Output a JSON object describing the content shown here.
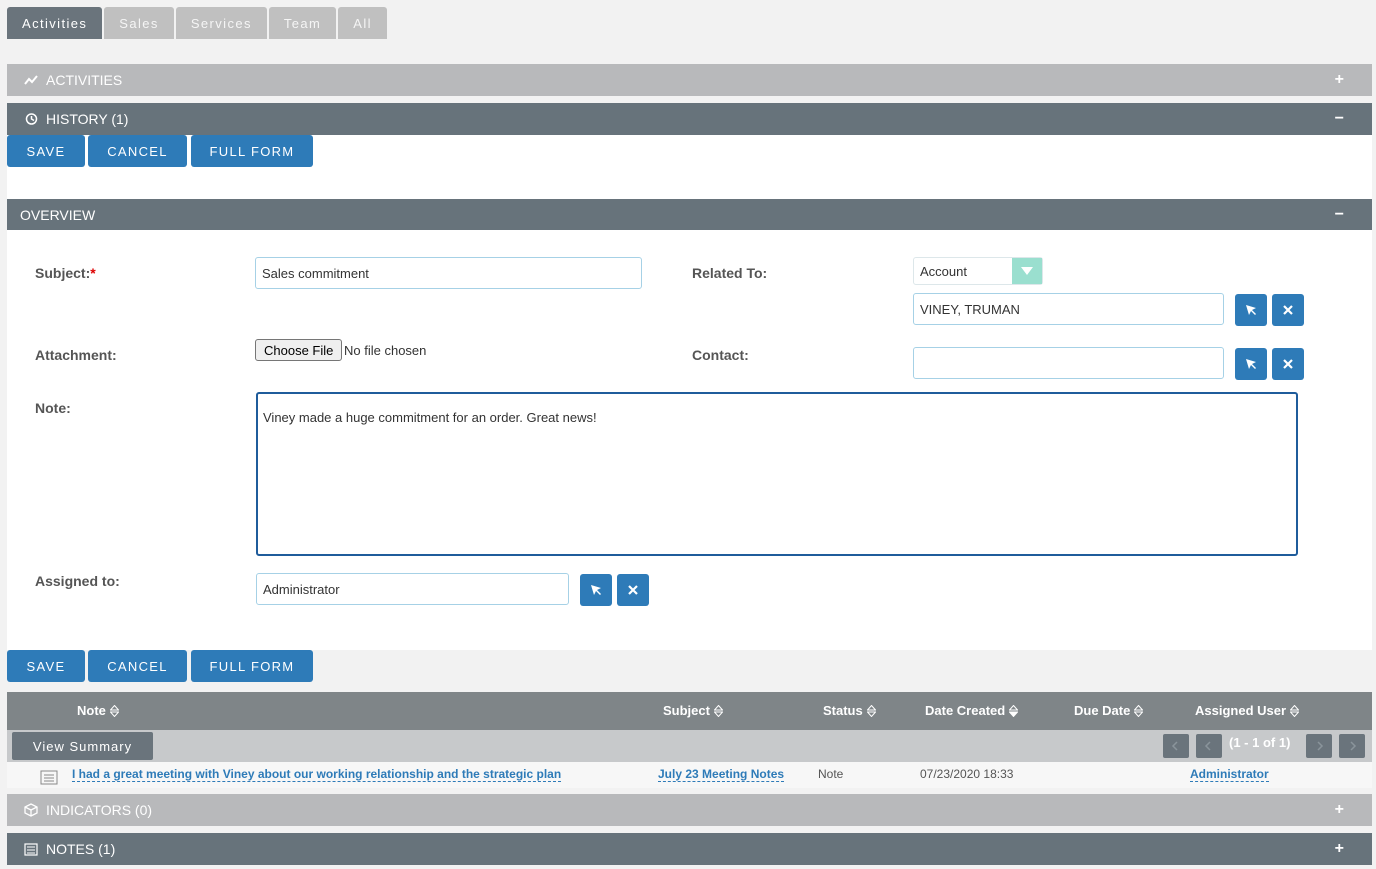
{
  "tabs": [
    "Activities",
    "Sales",
    "Services",
    "Team",
    "All"
  ],
  "panels": {
    "activities": {
      "title": "ACTIVITIES",
      "toggle": "+"
    },
    "history": {
      "title": "HISTORY (1)",
      "toggle": "−"
    },
    "overview": {
      "title": "OVERVIEW",
      "toggle": "−"
    },
    "indicators": {
      "title": "INDICATORS (0)",
      "toggle": "+"
    },
    "notes": {
      "title": "NOTES (1)",
      "toggle": "+"
    }
  },
  "buttons": {
    "save": "SAVE",
    "cancel": "CANCEL",
    "full_form": "FULL FORM"
  },
  "form": {
    "subject_label": "Subject:",
    "required_mark": "*",
    "subject_value": "Sales commitment",
    "related_label": "Related To:",
    "related_type": "Account",
    "related_value": "VINEY, TRUMAN",
    "attachment_label": "Attachment:",
    "choose_file": "Choose File",
    "no_file": "No file chosen",
    "contact_label": "Contact:",
    "contact_value": "",
    "note_label": "Note:",
    "note_value": "Viney made a huge commitment for an order.  Great news!",
    "assigned_label": "Assigned to:",
    "assigned_value": "Administrator"
  },
  "table": {
    "columns": [
      "Note",
      "Subject",
      "Status",
      "Date Created",
      "Due Date",
      "Assigned User"
    ],
    "view_summary": "View Summary",
    "pagination": "(1 - 1 of 1)",
    "rows": [
      {
        "note": "I had a great meeting with Viney about our working relationship and the strategic plan",
        "subject": "July 23 Meeting Notes",
        "status": "Note",
        "date_created": "07/23/2020 18:33",
        "due_date": "",
        "assigned_user": "Administrator"
      }
    ]
  },
  "colors": {
    "accent": "#2e7bb8",
    "header_dark": "#67737b",
    "header_light": "#b8b9bb",
    "dropdown_arrow": "#9adfcf"
  }
}
